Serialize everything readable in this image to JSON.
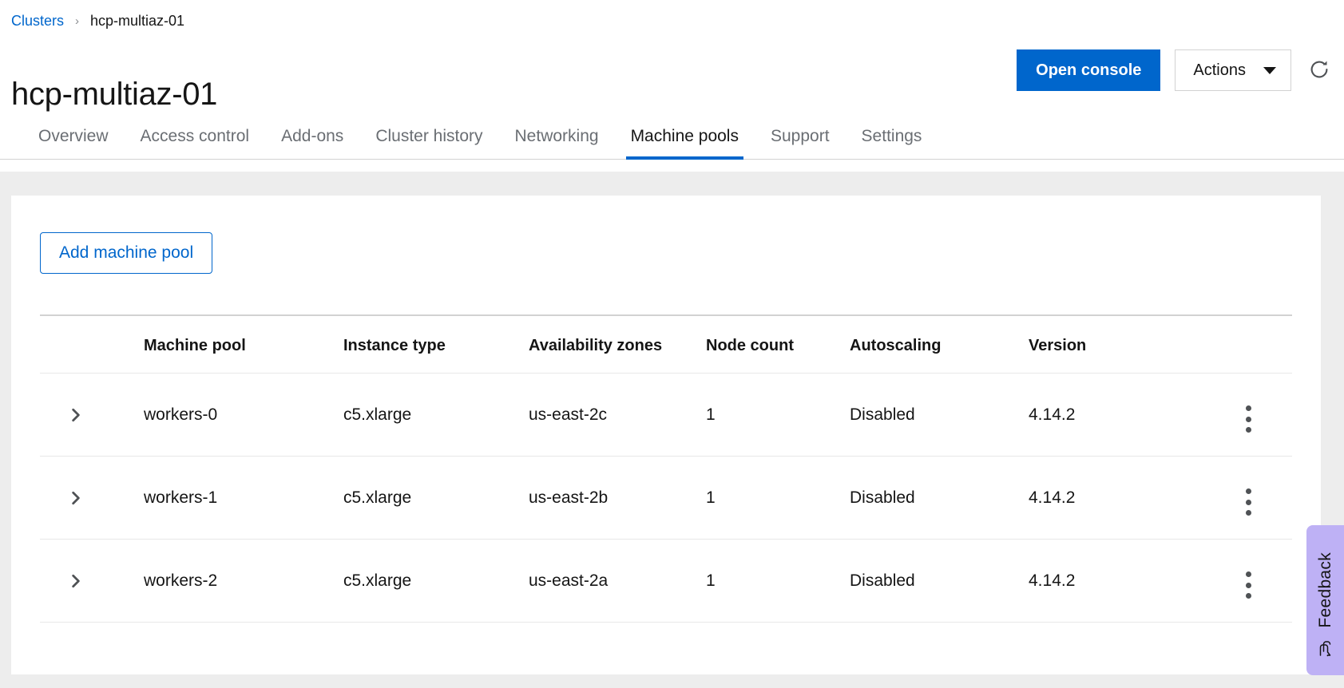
{
  "breadcrumb": {
    "root_label": "Clusters",
    "separator": "›",
    "current_label": "hcp-multiaz-01"
  },
  "header": {
    "title": "hcp-multiaz-01",
    "open_console_label": "Open console",
    "actions_label": "Actions",
    "refresh_icon": "refresh-icon",
    "caret_icon": "chevron-down-icon"
  },
  "tabs": [
    {
      "label": "Overview",
      "active": false
    },
    {
      "label": "Access control",
      "active": false
    },
    {
      "label": "Add-ons",
      "active": false
    },
    {
      "label": "Cluster history",
      "active": false
    },
    {
      "label": "Networking",
      "active": false
    },
    {
      "label": "Machine pools",
      "active": true
    },
    {
      "label": "Support",
      "active": false
    },
    {
      "label": "Settings",
      "active": false
    }
  ],
  "machine_pools": {
    "add_button_label": "Add machine pool",
    "columns": [
      "Machine pool",
      "Instance type",
      "Availability zones",
      "Node count",
      "Autoscaling",
      "Version"
    ],
    "rows": [
      {
        "name": "workers-0",
        "instance_type": "c5.xlarge",
        "availability_zone": "us-east-2c",
        "node_count": "1",
        "autoscaling": "Disabled",
        "version": "4.14.2",
        "expand_icon": "chevron-right-icon",
        "kebab_icon": "kebab-menu-icon"
      },
      {
        "name": "workers-1",
        "instance_type": "c5.xlarge",
        "availability_zone": "us-east-2b",
        "node_count": "1",
        "autoscaling": "Disabled",
        "version": "4.14.2",
        "expand_icon": "chevron-right-icon",
        "kebab_icon": "kebab-menu-icon"
      },
      {
        "name": "workers-2",
        "instance_type": "c5.xlarge",
        "availability_zone": "us-east-2a",
        "node_count": "1",
        "autoscaling": "Disabled",
        "version": "4.14.2",
        "expand_icon": "chevron-right-icon",
        "kebab_icon": "kebab-menu-icon"
      }
    ]
  },
  "feedback": {
    "label": "Feedback",
    "icon": "speech-bubble-icon",
    "color": "#beb1f5"
  },
  "colors": {
    "primary_blue": "#0066cc",
    "link_blue": "#0066cc",
    "page_background": "#ededed",
    "text": "#151515",
    "muted_text": "#6a6e73",
    "border": "#d2d2d2"
  }
}
